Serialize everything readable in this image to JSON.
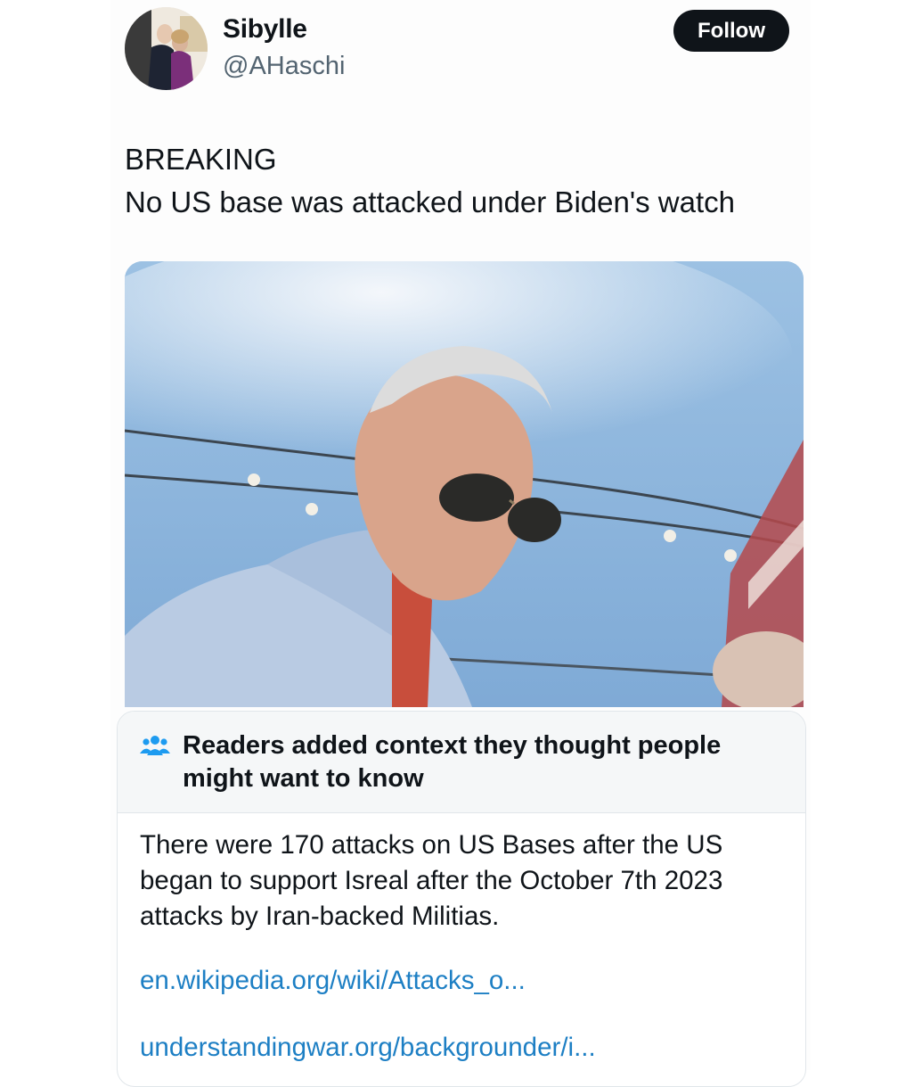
{
  "author": {
    "display_name": "Sibylle",
    "handle": "@AHaschi",
    "avatar_icon": "profile-photo"
  },
  "follow_label": "Follow",
  "tweet": {
    "lines": [
      "BREAKING",
      "No US base was attacked under Biden's watch"
    ]
  },
  "community_note": {
    "icon": "people-icon",
    "title": "Readers added context they thought people might want to know",
    "body_lines": [
      "There were 170 attacks on US Bases after the US",
      "began to support Isreal after the October 7th 2023",
      "attacks by Iran-backed Militias."
    ],
    "links": [
      "en.wikipedia.org/wiki/Attacks_o...",
      "understandingwar.org/backgrounder/i..."
    ]
  },
  "colors": {
    "follow_bg": "#0f1419",
    "link": "#1d7fc4",
    "note_icon": "#1d9bf0",
    "handle": "#536471"
  }
}
